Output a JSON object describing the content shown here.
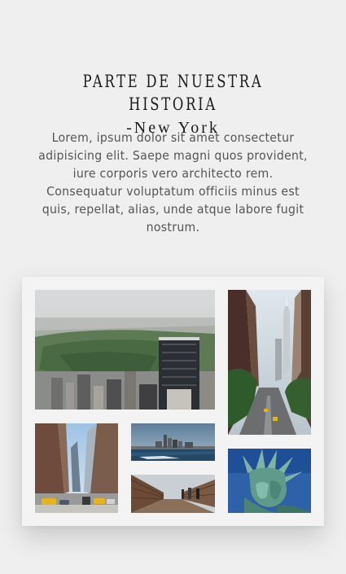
{
  "section": {
    "title": "PARTE DE NUESTRA HISTORIA",
    "subtitle": "-New York",
    "description": "Lorem, ipsum dolor sit amet consectetur adipisicing elit. Saepe magni quos provident, iure corporis vero architecto rem. Consequatur voluptatum officiis minus est quis, repellat, alias, unde atque labore fugit nostrum."
  },
  "gallery": {
    "photos": [
      {
        "name": "photo-central-park-aerial"
      },
      {
        "name": "photo-chrysler-building-street"
      },
      {
        "name": "photo-manhattan-street-taxis"
      },
      {
        "name": "photo-skyline-from-water"
      },
      {
        "name": "photo-brooklyn-bridge-walkway"
      },
      {
        "name": "photo-statue-of-liberty"
      }
    ]
  },
  "colors": {
    "page_background": "#efefef",
    "card_background": "#f3f3f3",
    "heading_text": "#1a1a1a",
    "body_text": "#555555"
  }
}
